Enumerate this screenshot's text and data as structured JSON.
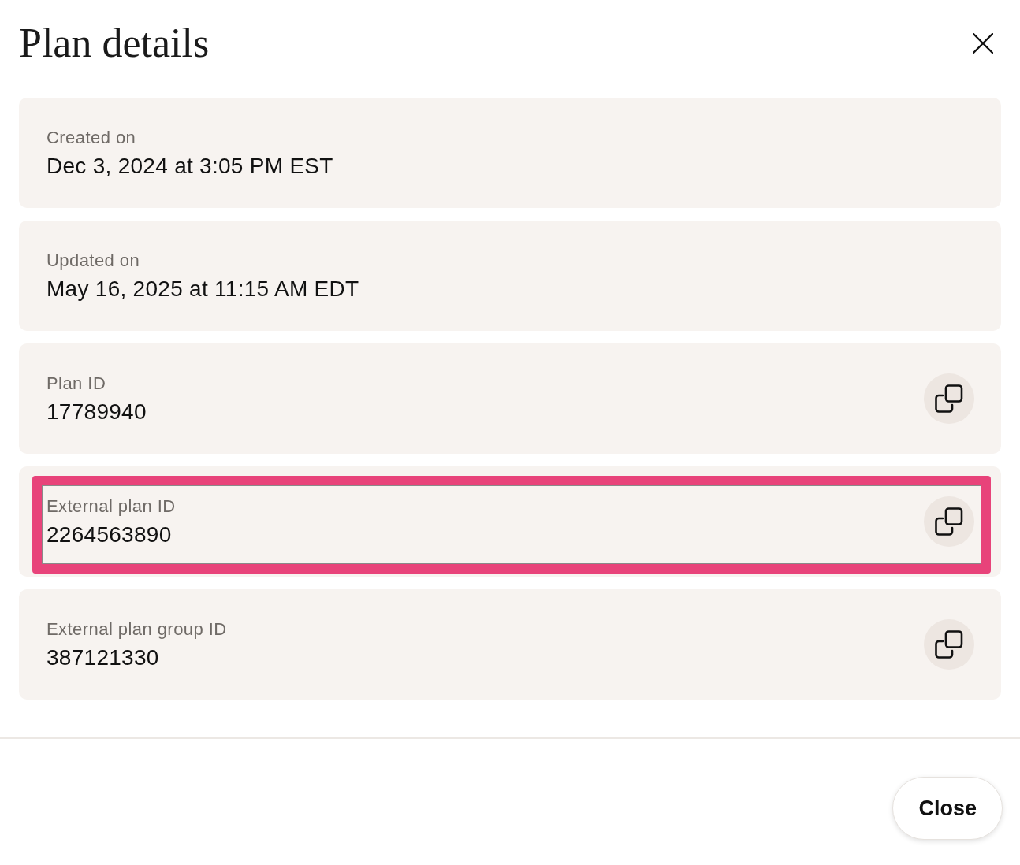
{
  "dialog": {
    "title": "Plan details"
  },
  "fields": [
    {
      "label": "Created on",
      "value": "Dec 3, 2024 at 3:05 PM EST",
      "copyable": false,
      "highlighted": false
    },
    {
      "label": "Updated on",
      "value": "May 16, 2025 at 11:15 AM EDT",
      "copyable": false,
      "highlighted": false
    },
    {
      "label": "Plan ID",
      "value": "17789940",
      "copyable": true,
      "highlighted": false
    },
    {
      "label": "External plan ID",
      "value": "2264563890",
      "copyable": true,
      "highlighted": true
    },
    {
      "label": "External plan group ID",
      "value": "387121330",
      "copyable": true,
      "highlighted": false
    }
  ],
  "footer": {
    "buttons": [
      "Close"
    ]
  }
}
